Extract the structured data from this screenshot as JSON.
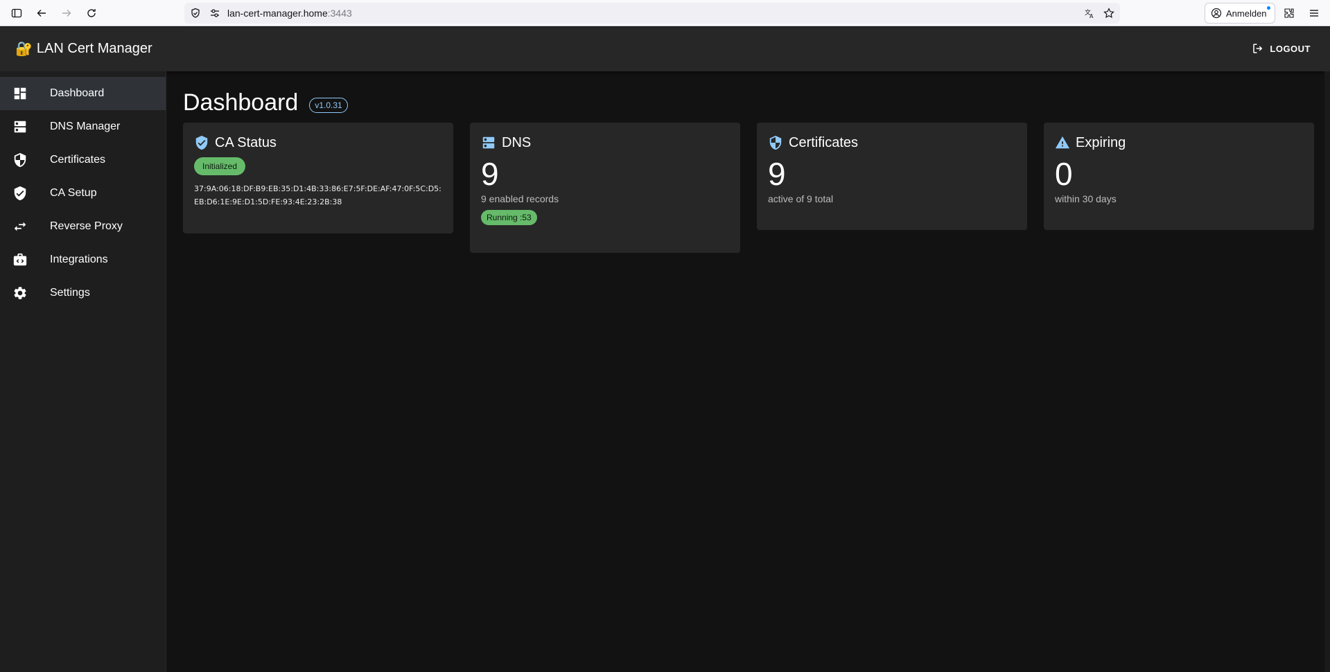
{
  "browser": {
    "url_host": "lan-cert-manager.home",
    "url_port": ":3443",
    "signin_label": "Anmelden"
  },
  "app": {
    "title_emoji": "🔐",
    "title": "LAN Cert Manager",
    "logout_label": "LOGOUT"
  },
  "sidebar": {
    "items": [
      {
        "label": "Dashboard",
        "icon": "dashboard-icon",
        "active": true
      },
      {
        "label": "DNS Manager",
        "icon": "dns-icon"
      },
      {
        "label": "Certificates",
        "icon": "shield-icon"
      },
      {
        "label": "CA Setup",
        "icon": "verified-shield-icon"
      },
      {
        "label": "Reverse Proxy",
        "icon": "swap-arrows-icon"
      },
      {
        "label": "Integrations",
        "icon": "integration-icon"
      },
      {
        "label": "Settings",
        "icon": "gear-icon"
      }
    ]
  },
  "page": {
    "title": "Dashboard",
    "version": "v1.0.31"
  },
  "cards": {
    "ca": {
      "title": "CA Status",
      "status": "Initialized",
      "fingerprint": "37:9A:06:18:DF:B9:EB:35:D1:4B:33:86:E7:5F:DE:AF:47:0F:5C:D5:EB:D6:1E:9E:D1:5D:FE:93:4E:23:2B:38"
    },
    "dns": {
      "title": "DNS",
      "count": "9",
      "subtitle": "9 enabled records",
      "status": "Running :53"
    },
    "certificates": {
      "title": "Certificates",
      "count": "9",
      "subtitle": "active of 9 total"
    },
    "expiring": {
      "title": "Expiring",
      "count": "0",
      "subtitle": "within 30 days"
    }
  },
  "colors": {
    "accent": "#90caf9",
    "success": "#66bb6a",
    "background": "#121212",
    "surface": "#272727"
  }
}
